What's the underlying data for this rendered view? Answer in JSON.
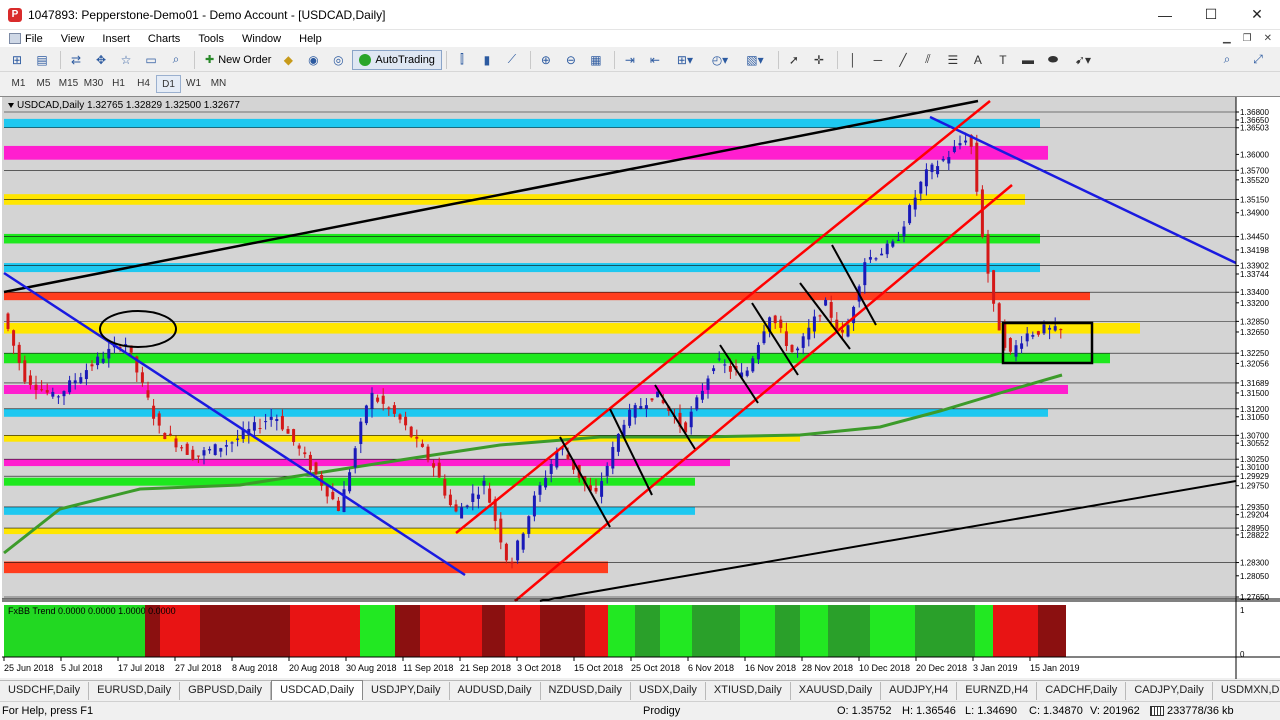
{
  "window": {
    "title": "1047893: Pepperstone-Demo01 - Demo Account - [USDCAD,Daily]",
    "minimize": "—",
    "maximize": "☐",
    "close": "✕"
  },
  "menu": [
    "File",
    "View",
    "Insert",
    "Charts",
    "Tools",
    "Window",
    "Help"
  ],
  "toolbar": {
    "new_order": "New Order",
    "autotrading": "AutoTrading"
  },
  "timeframes": [
    "M1",
    "M5",
    "M15",
    "M30",
    "H1",
    "H4",
    "D1",
    "W1",
    "MN"
  ],
  "active_timeframe": "D1",
  "chart": {
    "symbol_line": "USDCAD,Daily  1.32765 1.32829 1.32500 1.32677",
    "indicator_label": "FxBB Trend 0.0000 0.0000 1.0000 0.0000",
    "price_labels": [
      "1.36800",
      "1.36650",
      "1.36503",
      "1.36000",
      "1.35700",
      "1.35520",
      "1.35150",
      "1.34900",
      "1.34450",
      "1.34198",
      "1.33902",
      "1.33744",
      "1.33400",
      "1.33200",
      "1.32850",
      "1.32650",
      "1.32250",
      "1.32056",
      "1.31689",
      "1.31500",
      "1.31200",
      "1.31050",
      "1.30700",
      "1.30552",
      "1.30250",
      "1.30100",
      "1.29929",
      "1.29750",
      "1.29350",
      "1.29204",
      "1.28950",
      "1.28822",
      "1.28300",
      "1.28050",
      "1.27650"
    ],
    "indicator_scale": [
      "1",
      "0"
    ],
    "date_labels": [
      "25 Jun 2018",
      "5 Jul 2018",
      "17 Jul 2018",
      "27 Jul 2018",
      "8 Aug 2018",
      "20 Aug 2018",
      "30 Aug 2018",
      "11 Sep 2018",
      "21 Sep 2018",
      "3 Oct 2018",
      "15 Oct 2018",
      "25 Oct 2018",
      "6 Nov 2018",
      "16 Nov 2018",
      "28 Nov 2018",
      "10 Dec 2018",
      "20 Dec 2018",
      "3 Jan 2019",
      "15 Jan 2019"
    ]
  },
  "tabs": [
    "USDCHF,Daily",
    "EURUSD,Daily",
    "GBPUSD,Daily",
    "USDCAD,Daily",
    "USDJPY,Daily",
    "AUDUSD,Daily",
    "NZDUSD,Daily",
    "USDX,Daily",
    "XTIUSD,Daily",
    "XAUUSD,Daily",
    "AUDJPY,H4",
    "EURNZD,H4",
    "CADCHF,Daily",
    "CADJPY,Daily",
    "USDMXN,Dail"
  ],
  "active_tab": "USDCAD,Daily",
  "status": {
    "help": "For Help, press F1",
    "profile": "Prodigy",
    "open": "O: 1.35752",
    "high": "H: 1.36546",
    "low": "L: 1.34690",
    "close": "C: 1.34870",
    "volume": "V: 201962",
    "memory": "233778/36 kb"
  },
  "colors": {
    "cyan_band": "#1ec8f0",
    "magenta_band": "#ff1ecf",
    "yellow_band": "#ffe600",
    "green_band": "#1ee81e",
    "orange_band": "#ff3d1e",
    "bull_candle": "#1a1ab8",
    "bear_candle": "#d41818",
    "ma_line": "#3c9b2a",
    "channel_red": "#ff0000",
    "trend_blue": "#1a1ae0"
  }
}
